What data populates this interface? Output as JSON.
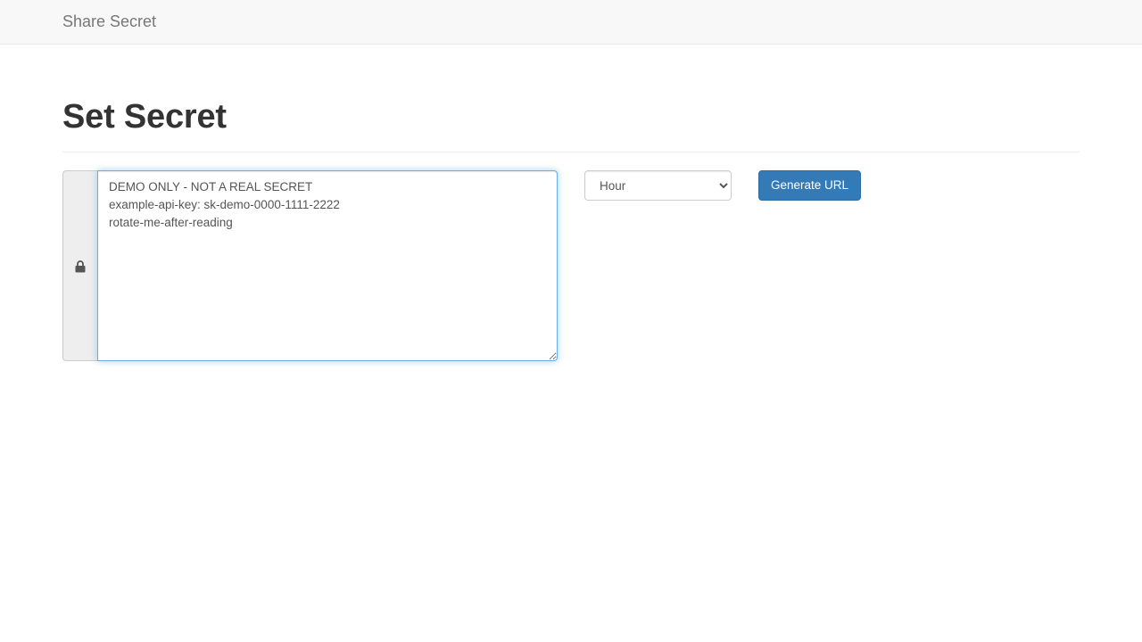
{
  "navbar": {
    "brand": "Share Secret"
  },
  "page": {
    "title": "Set Secret"
  },
  "form": {
    "lock_icon": "lock-icon",
    "secret_value": "DEMO ONLY - NOT A REAL SECRET\nexample-api-key: sk-demo-0000-1111-2222\nrotate-me-after-reading",
    "expiry_options": [
      "Hour"
    ],
    "expiry_selected": "Hour",
    "generate_label": "Generate URL"
  },
  "colors": {
    "navbar_bg": "#f8f8f8",
    "brand_text": "#777777",
    "primary_button": "#337ab7",
    "focus_border": "#66afe9"
  }
}
